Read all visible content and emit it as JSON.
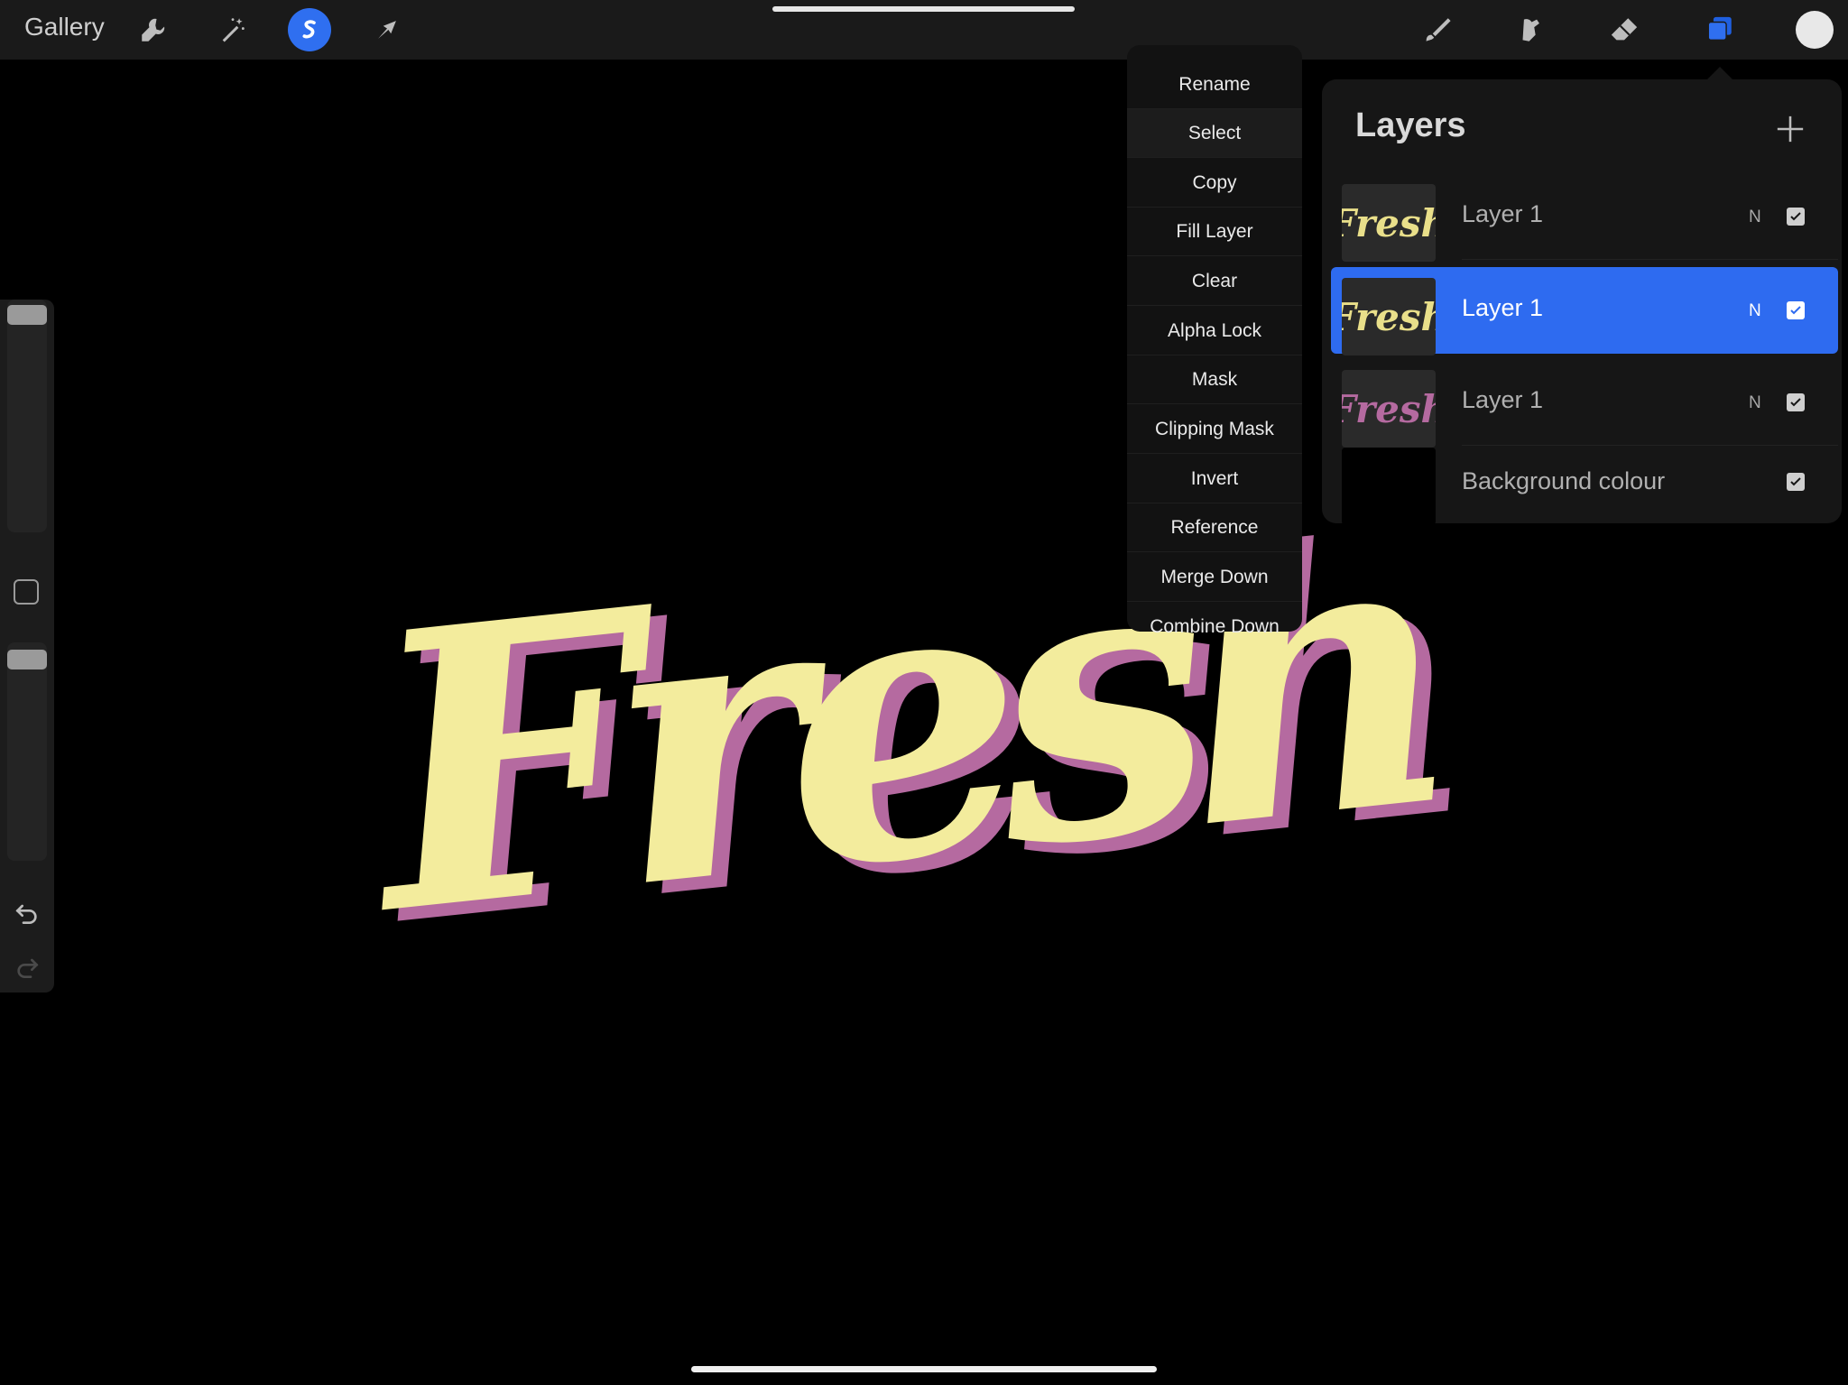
{
  "topbar": {
    "gallery_label": "Gallery",
    "left_tools": [
      "wrench-icon",
      "magic-wand-icon",
      "selection-icon",
      "move-arrow-icon"
    ],
    "active_tool": "selection-icon",
    "right_tools": [
      "brush-icon",
      "smudge-icon",
      "eraser-icon",
      "layers-icon",
      "color-swatch"
    ],
    "accent_color": "#2f6ff0",
    "current_color": "#e8e8e8"
  },
  "context_menu": {
    "items": [
      {
        "label": "Rename"
      },
      {
        "label": "Select"
      },
      {
        "label": "Copy"
      },
      {
        "label": "Fill Layer"
      },
      {
        "label": "Clear"
      },
      {
        "label": "Alpha Lock"
      },
      {
        "label": "Mask"
      },
      {
        "label": "Clipping Mask"
      },
      {
        "label": "Invert"
      },
      {
        "label": "Reference"
      },
      {
        "label": "Merge Down"
      },
      {
        "label": "Combine Down"
      }
    ]
  },
  "layers_panel": {
    "title": "Layers",
    "layers": [
      {
        "name": "Layer 1",
        "blend": "N",
        "visible": true,
        "selected": false,
        "thumb_text": "Fresh",
        "thumb_color": "#e9df8a"
      },
      {
        "name": "Layer 1",
        "blend": "N",
        "visible": true,
        "selected": true,
        "thumb_text": "Fresh",
        "thumb_color": "#e9df8a"
      },
      {
        "name": "Layer 1",
        "blend": "N",
        "visible": true,
        "selected": false,
        "thumb_text": "Fresh",
        "thumb_color": "#b56aa0"
      },
      {
        "name": "Background colour",
        "visible": true,
        "selected": false,
        "thumb_color": "#000000"
      }
    ]
  },
  "canvas": {
    "artwork_text": "Fresh",
    "fill_color": "#f3ec9d",
    "shadow_color": "#b56aa0",
    "background_color": "#000000"
  }
}
